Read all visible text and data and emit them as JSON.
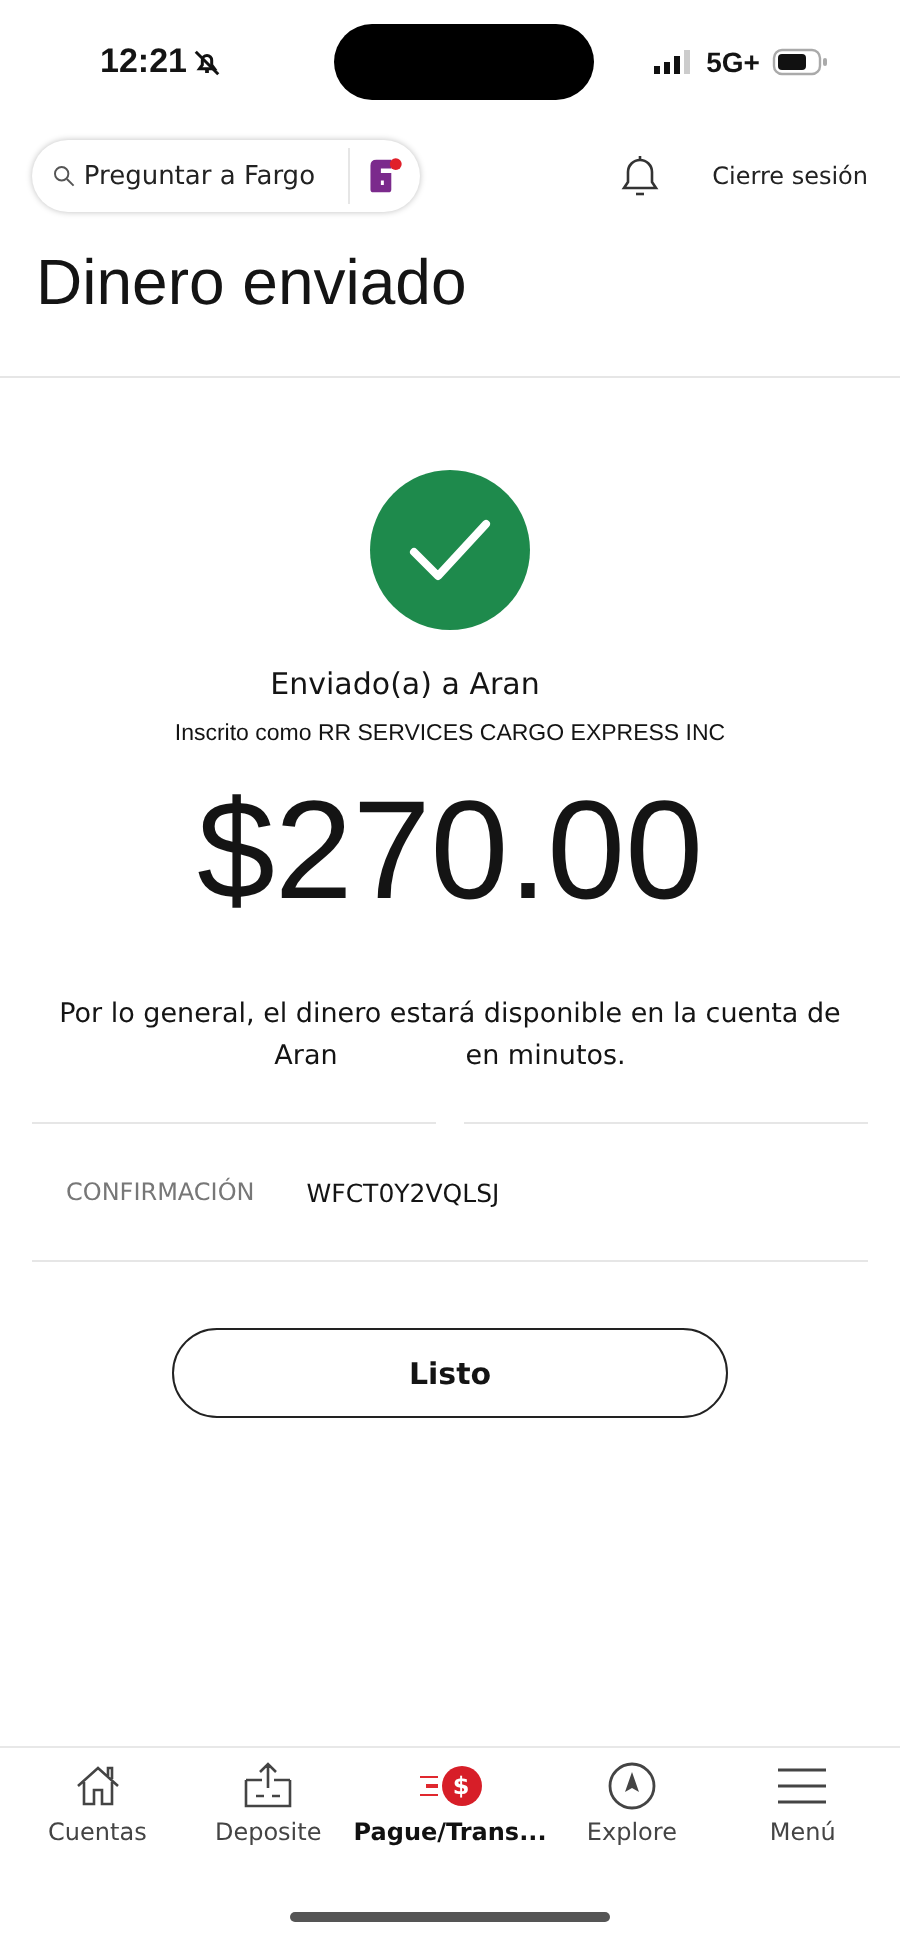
{
  "status_bar": {
    "time": "12:21",
    "network": "5G+"
  },
  "header": {
    "search": {
      "placeholder": "Preguntar a Fargo"
    },
    "logout": "Cierre sesión"
  },
  "title": "Dinero enviado",
  "result": {
    "recipient_line": "Enviado(a) a Aran",
    "enrolled_line": "Inscrito como RR SERVICES CARGO EXPRESS INC",
    "amount": "$270.00",
    "note_line_1": "Por lo general, el dinero estará disponible en la cuenta de",
    "note_name": "Aran",
    "note_end": "en minutos."
  },
  "confirmation": {
    "label": "CONFIRMACIÓN",
    "value": "WFCT0Y2VQLSJ"
  },
  "done_button": "Listo",
  "nav": [
    {
      "kind": "home",
      "label": "Cuentas",
      "selected": false
    },
    {
      "kind": "deposit",
      "label": "Deposite",
      "selected": false
    },
    {
      "kind": "pay",
      "label": "Pague/Trans...",
      "badge": "$",
      "selected": true
    },
    {
      "kind": "explore",
      "label": "Explore",
      "selected": false
    },
    {
      "kind": "menu",
      "label": "Menú",
      "selected": false
    }
  ]
}
